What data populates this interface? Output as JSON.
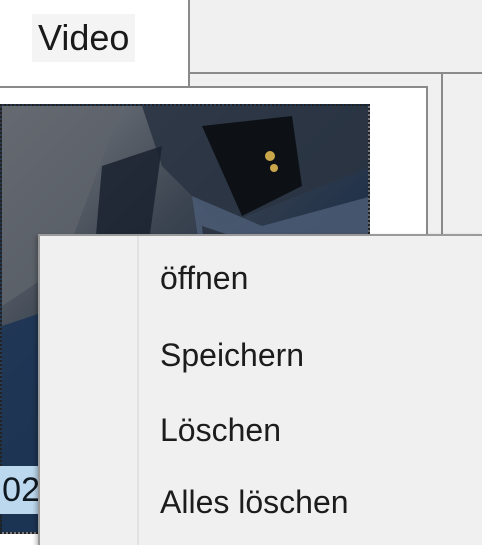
{
  "tabs": [
    {
      "label": "Video"
    }
  ],
  "thumbnail": {
    "label_fragment": "02"
  },
  "context_menu": {
    "items": [
      {
        "label": "öffnen"
      },
      {
        "label": "Speichern"
      },
      {
        "label": "Löschen"
      },
      {
        "label": "Alles löschen"
      }
    ]
  }
}
